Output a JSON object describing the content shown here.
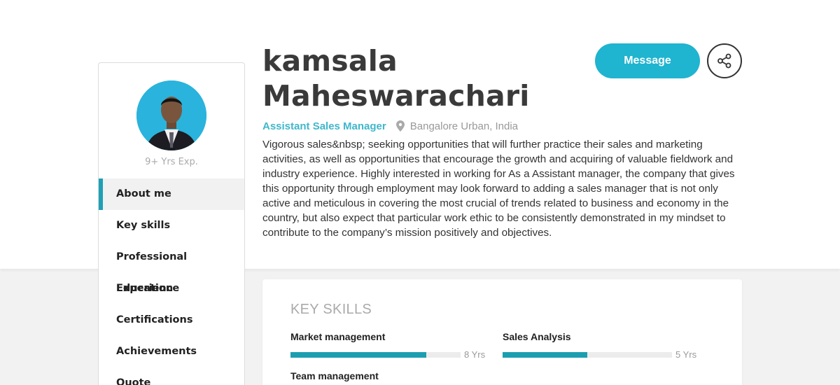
{
  "profile": {
    "name_line1": "kamsala",
    "name_line2": "Maheswarachari",
    "experience": "9+ Yrs Exp.",
    "job_title": "Assistant Sales Manager",
    "location": "Bangalore Urban, India",
    "about": "Vigorous sales&nbsp; seeking opportunities that will further practice their sales and marketing activities, as well as opportunities that encourage the growth and acquiring of valuable fieldwork and industry experience. Highly interested in working for As a Assistant manager, the company that gives this opportunity through employment may look forward to adding a sales manager that is not only active and meticulous in covering the most crucial of trends related to business and economy in the country, but also expect that particular work ethic to be consistently demonstrated in my mindset to contribute to the company’s mission positively and objectives."
  },
  "actions": {
    "message_label": "Message",
    "share_icon": "share-icon"
  },
  "sidebar": {
    "items": [
      {
        "label": "About me",
        "active": true
      },
      {
        "label": "Key skills"
      },
      {
        "label": "Professional Experience"
      },
      {
        "label": "Education"
      },
      {
        "label": "Certifications"
      },
      {
        "label": "Achievements"
      },
      {
        "label": "Quote"
      }
    ]
  },
  "key_skills": {
    "heading": "KEY SKILLS",
    "items": [
      {
        "name": "Market management",
        "years": "8 Yrs",
        "level": 0.8
      },
      {
        "name": "Sales Analysis",
        "years": "5 Yrs",
        "level": 0.5
      },
      {
        "name": "Team management",
        "years": "",
        "level": 0
      }
    ]
  },
  "colors": {
    "accent": "#1fb4cf",
    "bar_fill": "#1b9fb0",
    "title_text": "#40b7cc"
  }
}
